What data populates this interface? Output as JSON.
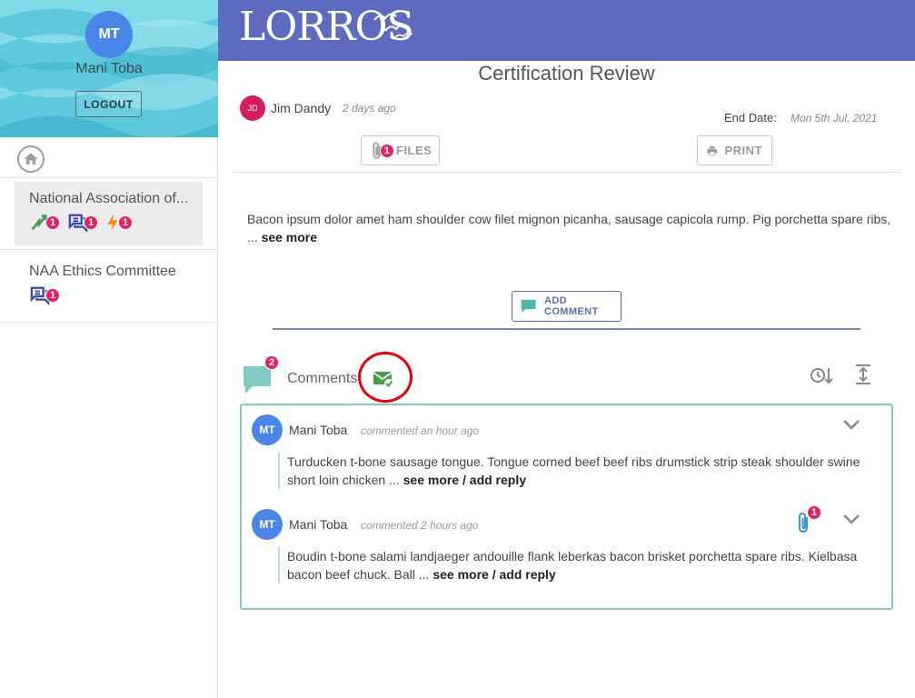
{
  "sidebar": {
    "user_initials": "MT",
    "user_name": "Mani Toba",
    "logout_label": "LOGOUT",
    "orgs": [
      {
        "title": "National Association of...",
        "badges": [
          "1",
          "1",
          "1"
        ]
      },
      {
        "title": "NAA Ethics Committee",
        "badges": [
          "1"
        ]
      }
    ]
  },
  "header": {
    "logo": "LORROS"
  },
  "main": {
    "title": "Certification Review",
    "author": {
      "initials": "JD",
      "name": "Jim Dandy",
      "time": "2 days ago"
    },
    "end_date_label": "End Date:",
    "end_date_value": "Mon 5th Jul, 2021",
    "files_label": "FILES",
    "files_count": "1",
    "print_label": "PRINT",
    "body_text": "Bacon ipsum dolor amet ham shoulder cow filet mignon picanha, sausage capicola rump. Pig porchetta spare ribs, ... ",
    "see_more": "see more",
    "add_comment_label": "ADD COMMENT",
    "comments_label": "Comments",
    "comments_count": "2"
  },
  "comments": [
    {
      "initials": "MT",
      "name": "Mani Toba",
      "time": "commented an hour ago",
      "text": "Turducken t-bone sausage tongue. Tongue corned beef beef ribs drumstick strip steak shoulder swine short loin chicken ... ",
      "link": "see more / add reply"
    },
    {
      "initials": "MT",
      "name": "Mani Toba",
      "time": "commented 2 hours ago",
      "attachment_count": "1",
      "text": "Boudin t-bone salami landjaeger andouille flank leberkas bacon brisket porchetta spare ribs. Kielbasa bacon beef chuck. Ball ... ",
      "link": "see more / add reply"
    }
  ],
  "colors": {
    "header": "#5c6bc0",
    "badge": "#e91e63",
    "accent_teal": "#80cbc4",
    "highlight_circle": "#ee0000"
  }
}
